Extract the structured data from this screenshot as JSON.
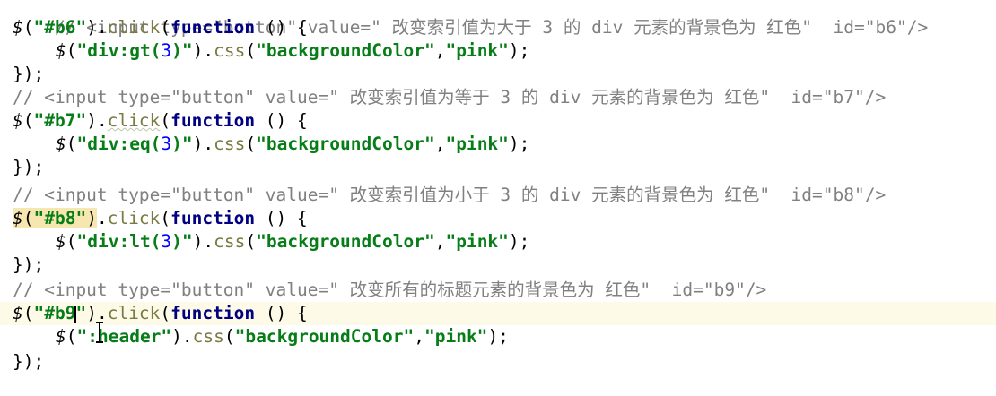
{
  "editor": {
    "language": "javascript",
    "lines": [
      {
        "comment": "// <input type=\"button\" value=\" 改变索引值为大于 3 的 div 元素的背景色为 红色\"  id=\"b6\"/>"
      },
      {
        "selector_id": "\"#b6\"",
        "event": "click",
        "kw": "function",
        "tail": " () {"
      },
      {
        "inner_selector_pre": "\"div:gt(",
        "inner_num": "3",
        "inner_selector_post": ")\"",
        "css_method": "css",
        "prop": "\"backgroundColor\"",
        "val": "\"pink\""
      },
      {
        "close": "});"
      },
      {
        "comment": "// <input type=\"button\" value=\" 改变索引值为等于 3 的 div 元素的背景色为 红色\"  id=\"b7\"/>"
      },
      {
        "selector_id": "\"#b7\"",
        "event": "click",
        "kw": "function",
        "tail": " () {"
      },
      {
        "inner_selector_pre": "\"div:eq(",
        "inner_num": "3",
        "inner_selector_post": ")\"",
        "css_method": "css",
        "prop": "\"backgroundColor\"",
        "val": "\"pink\""
      },
      {
        "close": "});"
      },
      {
        "comment": "// <input type=\"button\" value=\" 改变索引值为小于 3 的 div 元素的背景色为 红色\"  id=\"b8\"/>"
      },
      {
        "selector_id": "\"#b8\"",
        "event": "click",
        "kw": "function",
        "tail": " () {"
      },
      {
        "inner_selector_pre": "\"div:lt(",
        "inner_num": "3",
        "inner_selector_post": ")\"",
        "css_method": "css",
        "prop": "\"backgroundColor\"",
        "val": "\"pink\""
      },
      {
        "close": "});"
      },
      {
        "comment": "// <input type=\"button\" value=\" 改变所有的标题元素的背景色为 红色\"  id=\"b9\"/>"
      },
      {
        "selector_id_a": "\"#b9",
        "selector_id_b": "\"",
        "event": "click",
        "kw": "function",
        "tail": " () {"
      },
      {
        "inner_selector": "\":header\"",
        "css_method": "css",
        "prop": "\"backgroundColor\"",
        "val": "\"pink\""
      },
      {
        "close": "});"
      }
    ]
  },
  "colors": {
    "comment": "#808080",
    "string": "#067d17",
    "keyword": "#000080",
    "method": "#7a7a43",
    "number": "#0000ff",
    "current_line": "#fdfbe8",
    "match_highlight": "#f6e6b0"
  }
}
